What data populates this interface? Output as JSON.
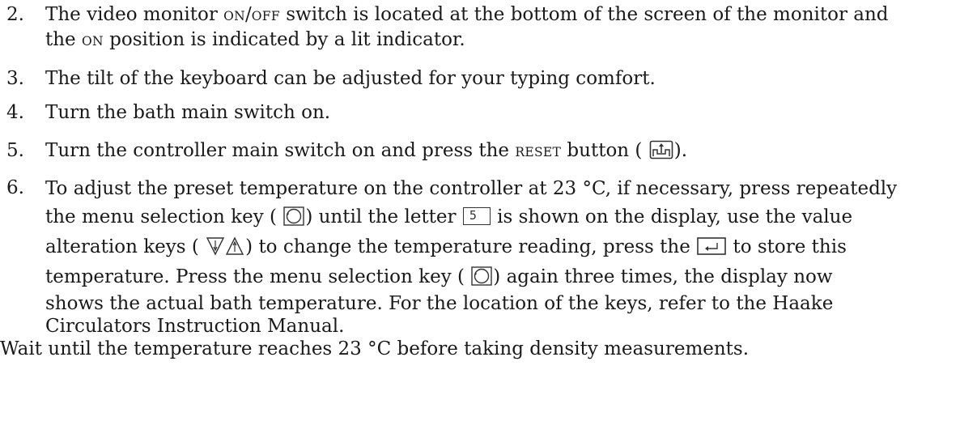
{
  "items": [
    {
      "number": "2.",
      "line1_a": "The video monitor ",
      "line1_on": "ON",
      "line1_slash": "/",
      "line1_off": "OFF",
      "line1_b": " switch is located at the bottom of the screen of the monitor and",
      "line2_a": "the ",
      "line2_on": "ON",
      "line2_b": " position is indicated by a lit indicator."
    },
    {
      "number": "3.",
      "text": "The tilt of the keyboard can be adjusted for your typing comfort."
    },
    {
      "number": "4.",
      "text": "Turn the bath main switch on."
    },
    {
      "number": "5.",
      "a": "Turn the controller main switch on and press the ",
      "reset": "RESET",
      "b": " button (",
      "c": ")."
    },
    {
      "number": "6.",
      "l1": "To adjust the preset temperature on the controller at 23 °C, if necessary, press repeatedly",
      "l2_a": "the menu selection key (",
      "l2_b": ") until the letter ",
      "l2_letter": "5",
      "l2_c": " is shown on the display, use the value",
      "l3_a": "alteration keys (",
      "l3_b": ") to change the temperature reading, press the ",
      "l3_c": " to store this",
      "l4_a": "temperature. Press the menu selection key (",
      "l4_b": ") again three times, the display now",
      "l5": "shows the actual bath temperature. For the location of the keys, refer to the Haake",
      "l6": "Circulators Instruction Manual.",
      "l7": "Wait until the temperature reaches 23 °C before taking density measurements."
    }
  ],
  "icons": {
    "reset_key": "reset-arrow-icon",
    "menu_key": "menu-circle-icon",
    "display_letter_key": "display-letter-box",
    "value_keys": "down-up-triangle-icons",
    "enter_key": "enter-return-icon"
  }
}
